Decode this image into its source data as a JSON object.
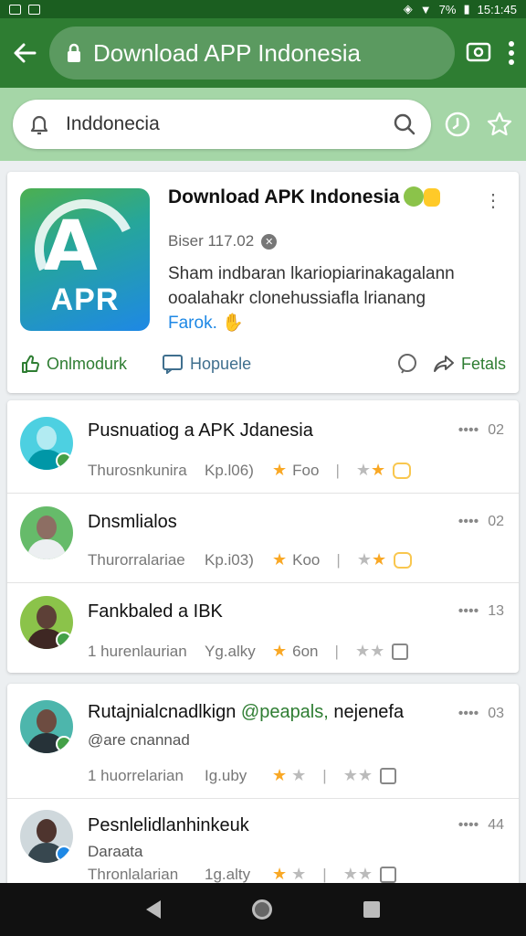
{
  "status_bar": {
    "battery": "7%",
    "time": "15:1:45"
  },
  "app_bar": {
    "title": "Download APP Indonesia"
  },
  "search": {
    "query": "Inddonecia"
  },
  "app_card": {
    "title": "Download APK Indonesia",
    "meta": "Biser 117.02",
    "desc_line1": "Sham indbaran lkariopiarinakagalann",
    "desc_line2": "ooalahakr clonehussiafla lrianang",
    "desc_link": "Farok.",
    "action_left": "Onlmodurk",
    "action_mid": "Hopuele",
    "action_right": "Fetals"
  },
  "list_a": [
    {
      "title": "Pusnuatiog a APK Jdanesia",
      "meta1": "Thurosnkunira",
      "meta2": "Kp.l06)",
      "rating": "Foo",
      "right": "02",
      "avatar_color": "#26a69a"
    },
    {
      "title": "Dnsmlialos",
      "meta1": "Thurorralariae",
      "meta2": "Kp.i03)",
      "rating": "Koo",
      "right": "02",
      "avatar_color": "#2e7d32"
    },
    {
      "title": "Fankbaled a IBK",
      "meta1": "1 hurenlaurian",
      "meta2": "Yg.alky",
      "rating": "6on",
      "right": "13",
      "avatar_color": "#558b2f"
    }
  ],
  "list_b": [
    {
      "title": "Rutajnialcnadlkign",
      "title_hl": "@peapals,",
      "title_tail": "nejenefa",
      "sub": "@are cnannad",
      "meta1": "1 huorrelarian",
      "meta2": "Ig.uby",
      "right": "03",
      "avatar_color": "#00897b"
    },
    {
      "title": "Pesnlelidlanhinkeuk",
      "title_hl": "",
      "title_tail": "",
      "sub": "Daraata",
      "meta1": "Thronlalarian",
      "meta2": "1g.alty",
      "right": "44",
      "avatar_color": "#90a4ae"
    }
  ]
}
